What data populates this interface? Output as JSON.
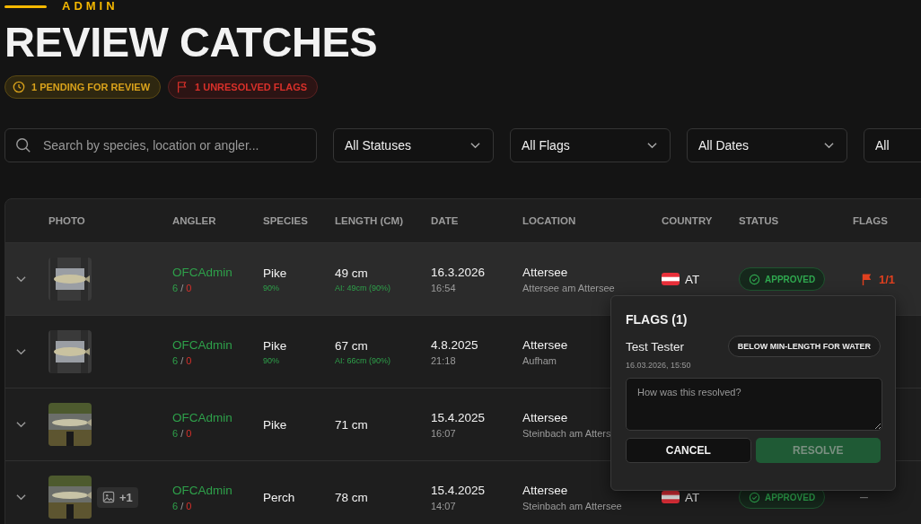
{
  "header": {
    "eyebrow": "ADMIN",
    "title": "REVIEW CATCHES",
    "badges": [
      {
        "kind": "pending",
        "label": "1 PENDING FOR REVIEW"
      },
      {
        "kind": "flags",
        "label": "1 UNRESOLVED FLAGS"
      }
    ]
  },
  "filters": {
    "search": {
      "placeholder": "Search by species, location or angler..."
    },
    "selects": [
      "All Statuses",
      "All Flags",
      "All Dates",
      "All"
    ]
  },
  "table": {
    "columns": [
      "PHOTO",
      "ANGLER",
      "SPECIES",
      "LENGTH (CM)",
      "DATE",
      "LOCATION",
      "COUNTRY",
      "STATUS",
      "FLAGS"
    ],
    "rows": [
      {
        "selected": true,
        "angler": "OFCAdmin",
        "approved": "6",
        "sep": "/",
        "rejected": "0",
        "species": "Pike",
        "species_conf": "90%",
        "length": "49 cm",
        "ai_length": "AI: 49cm (90%)",
        "date": "16.3.2026",
        "time": "16:54",
        "location": "Attersee",
        "place": "Attersee am Attersee",
        "country": "AT",
        "status": "APPROVED",
        "flags": "1/1"
      },
      {
        "selected": false,
        "angler": "OFCAdmin",
        "approved": "6",
        "sep": "/",
        "rejected": "0",
        "species": "Pike",
        "species_conf": "90%",
        "length": "67 cm",
        "ai_length": "AI: 66cm (90%)",
        "date": "4.8.2025",
        "time": "21:18",
        "location": "Attersee",
        "place": "Aufham"
      },
      {
        "selected": false,
        "angler": "OFCAdmin",
        "approved": "6",
        "sep": "/",
        "rejected": "0",
        "species": "Pike",
        "length": "71 cm",
        "date": "15.4.2025",
        "time": "16:07",
        "location": "Attersee",
        "place": "Steinbach am Atters"
      },
      {
        "selected": false,
        "extra_photos": "+1",
        "angler": "OFCAdmin",
        "approved": "6",
        "sep": "/",
        "rejected": "0",
        "species": "Perch",
        "length": "78 cm",
        "date": "15.4.2025",
        "time": "14:07",
        "location": "Attersee",
        "place": "Steinbach am Attersee",
        "country": "AT",
        "status": "APPROVED",
        "flags": "–"
      }
    ]
  },
  "popover": {
    "title": "FLAGS (1)",
    "entries": [
      {
        "reporter": "Test Tester",
        "reason": "BELOW MIN-LENGTH FOR WATER",
        "time": "16.03.2026, 15:50"
      }
    ],
    "note": {
      "placeholder": "How was this resolved?"
    },
    "buttons": [
      {
        "kind": "cancel",
        "label": "CANCEL"
      },
      {
        "kind": "resolve",
        "label": "RESOLVE",
        "disabled": true
      }
    ]
  }
}
